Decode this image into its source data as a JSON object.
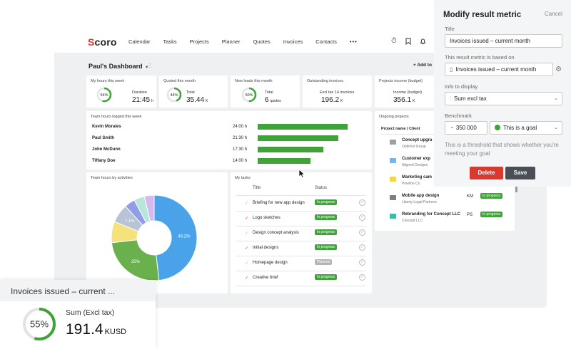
{
  "app": {
    "logo": "Scoro",
    "nav": [
      "Calendar",
      "Tasks",
      "Projects",
      "Planner",
      "Quotes",
      "Invoices",
      "Contacts",
      "•••"
    ],
    "top_icons": [
      "timer-icon",
      "bookmark-icon",
      "bell-icon"
    ],
    "dashboard_title": "Paul's Dashboard",
    "add_label": "+ Add to"
  },
  "kpis": [
    {
      "title": "My hours this week",
      "pct": "54%",
      "pct_value": 54,
      "label": "Duration",
      "value": "21:45",
      "unit": "h"
    },
    {
      "title": "Quoted this month",
      "pct": "44%",
      "pct_value": 44,
      "label": "Total",
      "value": "35.44",
      "unit": "K"
    },
    {
      "title": "New leads this month",
      "pct": "50%",
      "pct_value": 50,
      "label": "Total",
      "value": "6",
      "unit": "quotes"
    },
    {
      "title": "Outstanding invoices",
      "label": "Excl tax 14 invoices",
      "value": "196.2",
      "unit": "K"
    },
    {
      "title": "Projects income (budget)",
      "label": "Income (budget)",
      "value": "356.1",
      "unit": "K"
    }
  ],
  "team_hours": {
    "title": "Team hours logged this week",
    "rows": [
      {
        "name": "Kevin Morales",
        "time": "24:00 h",
        "hours": 24.0
      },
      {
        "name": "Paul Smith",
        "time": "21:30 h",
        "hours": 21.5
      },
      {
        "name": "John McDunn",
        "time": "17:30 h",
        "hours": 17.5
      },
      {
        "name": "Tiffany Doe",
        "time": "14:00 h",
        "hours": 14.0
      }
    ]
  },
  "activities": {
    "title": "Team hours by activities",
    "slices": [
      {
        "value": 48.2,
        "label": "48.2%",
        "color": "#4aa3e8"
      },
      {
        "value": 25,
        "label": "25%",
        "color": "#6ab04c"
      },
      {
        "value": 8,
        "label": "",
        "color": "#f5e27a"
      },
      {
        "value": 7.1,
        "label": "7.1%",
        "color": "#b9c3d6"
      },
      {
        "value": 4,
        "label": "",
        "color": "#8f9ee6"
      },
      {
        "value": 4,
        "label": "",
        "color": "#b8e6da"
      },
      {
        "value": 3.7,
        "label": "",
        "color": "#d6b8ee"
      }
    ]
  },
  "tasks": {
    "title": "My tasks",
    "col_title": "Title",
    "col_status": "Status",
    "rows": [
      {
        "name": "Briefing for new app design",
        "status": "In progress",
        "color": "#3fa33a",
        "check_color": "#f0b429"
      },
      {
        "name": "Logo sketches",
        "status": "In progress",
        "color": "#3fa33a",
        "check_color": "#e5342b"
      },
      {
        "name": "Design concept analysis",
        "status": "In progress",
        "color": "#3fa33a",
        "check_color": "#f0b429"
      },
      {
        "name": "Initial designs",
        "status": "In progress",
        "color": "#3fa33a",
        "check_color": "#2a7be0"
      },
      {
        "name": "Homepage design",
        "status": "Planned",
        "color": "#b5b5b5",
        "check_color": "#f0b429"
      },
      {
        "name": "Creative brief",
        "status": "In progress",
        "color": "#3fa33a",
        "check_color": "#2a7be0"
      }
    ]
  },
  "projects": {
    "title": "Ongoing projects",
    "col_header": "Project name | Client",
    "rows": [
      {
        "name": "Concept upgra",
        "client": "Optimist Group",
        "code": "",
        "status": "",
        "icon_color": "#9aa0a6"
      },
      {
        "name": "Customer exp",
        "client": "Aligned Designs",
        "code": "",
        "status": "",
        "icon_color": "#7ab3e8"
      },
      {
        "name": "Marketing cam",
        "client": "Pineline Co",
        "code": "",
        "status": "",
        "icon_color": "#f5d54a"
      },
      {
        "name": "Mobile app design",
        "client": "Liberty Legal Partners",
        "code": "KM",
        "status": "In progress",
        "icon_color": "#7a7f86"
      },
      {
        "name": "Rebranding for Concept LLC",
        "client": "Concept LLC",
        "code": "PS",
        "status": "In progress",
        "icon_color": "#43b8a8"
      }
    ]
  },
  "modal": {
    "title": "Modify result metric",
    "cancel": "Cancel",
    "title_label": "Title",
    "title_value": "Invoices issued – current month",
    "based_label": "This result metric is based on",
    "based_value": "Invoices issued – current month",
    "info_label": "Info to display",
    "info_value": "Sum excl tax",
    "benchmark_label": "Benchmark",
    "benchmark_value": "350 000",
    "goal_value": "This is a goal",
    "hint": "This is a threshold that shows whether you're meeting your goal",
    "delete_label": "Delete",
    "save_label": "Save"
  },
  "widget": {
    "title": "Invoices issued – current ...",
    "pct": "55%",
    "pct_value": 55,
    "label": "Sum (Excl tax)",
    "value": "191.4",
    "unit": "KUSD"
  }
}
